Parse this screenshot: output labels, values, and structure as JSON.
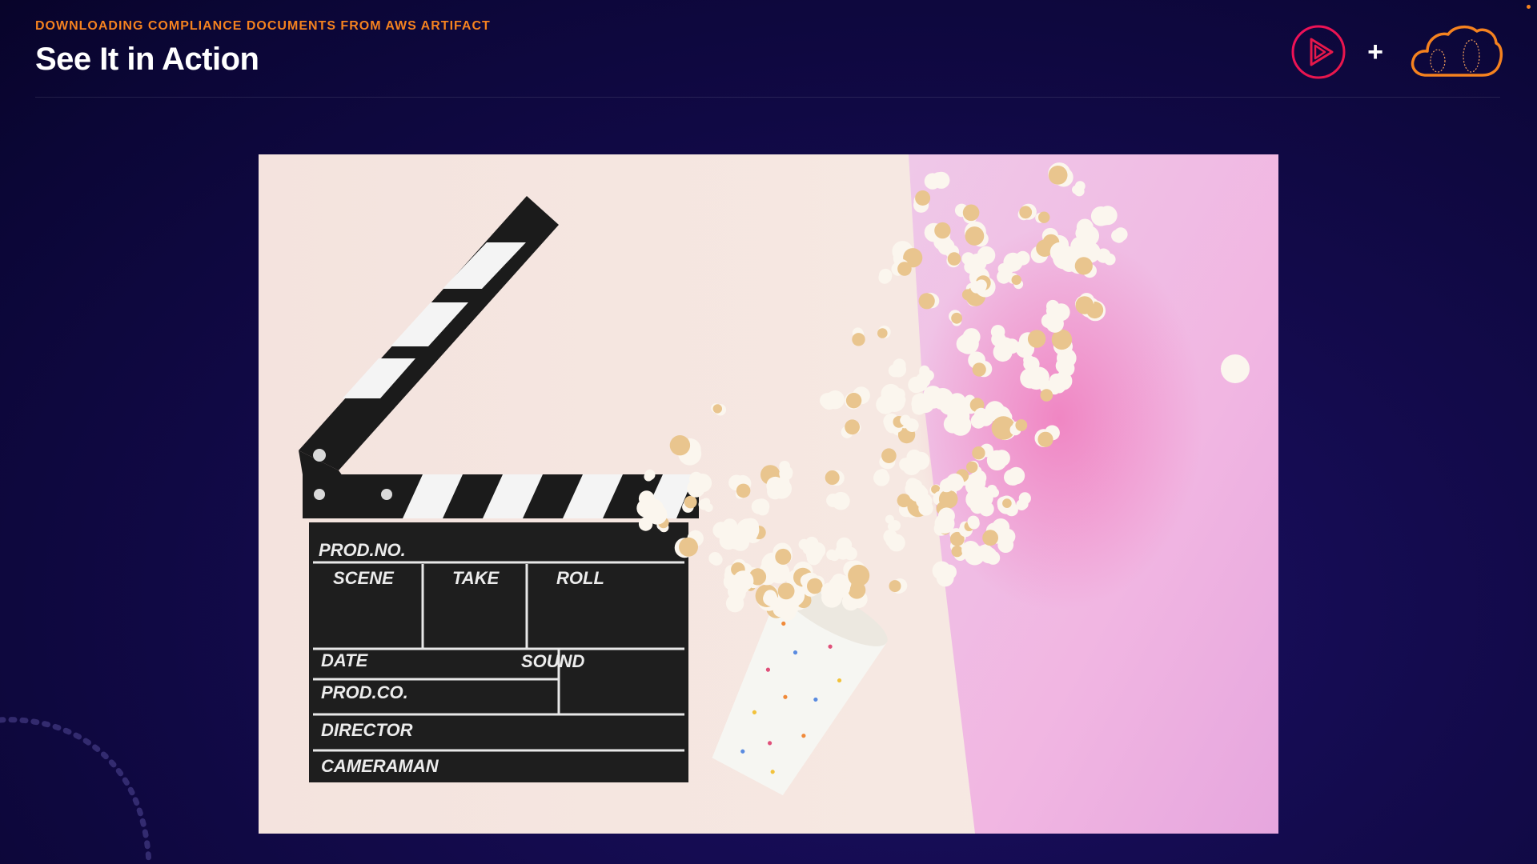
{
  "header": {
    "kicker": "DOWNLOADING COMPLIANCE DOCUMENTS FROM AWS ARTIFACT",
    "title": "See It in Action"
  },
  "logos": {
    "play_icon": "play-triangle-icon",
    "plus": "+",
    "cloud_icon": "cloud-icon"
  },
  "media": {
    "image_semantic": "clapperboard-and-popcorn-photo",
    "clapper_labels": {
      "prod_no": "PROD.NO.",
      "scene": "SCENE",
      "take": "TAKE",
      "roll": "ROLL",
      "date": "DATE",
      "sound": "SOUND",
      "prod_co": "PROD.CO.",
      "director": "DIRECTOR",
      "cameraman": "CAMERAMAN"
    }
  },
  "colors": {
    "accent_orange": "#f5821f",
    "play_red": "#e7184a",
    "background": "#0b0636"
  }
}
